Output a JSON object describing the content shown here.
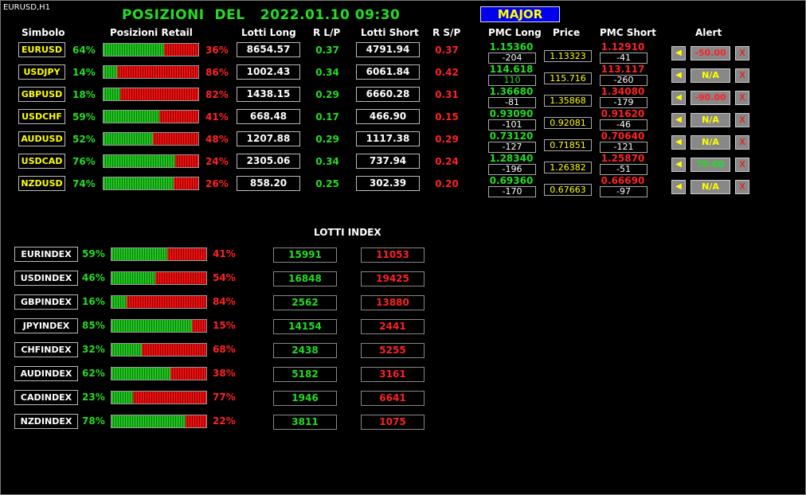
{
  "chart_label": "EURUSD,H1",
  "title": "POSIZIONI  DEL   2022.01.10 09:30",
  "major_button": "MAJOR",
  "headers": {
    "simbolo": "Simbolo",
    "posizioni_retail": "Posizioni Retail",
    "lotti_long": "Lotti Long",
    "r_lp": "R L/P",
    "lotti_short": "Lotti Short",
    "r_sp": "R S/P",
    "pmc_long": "PMC Long",
    "price": "Price",
    "pmc_short": "PMC Short",
    "alert": "Alert"
  },
  "pairs": [
    {
      "symbol": "EURUSD",
      "long_pct": "64%",
      "short_pct": "36%",
      "long_frac": 0.64,
      "lotti_long": "8654.57",
      "r_lp": "0.37",
      "lotti_short": "4791.94",
      "r_sp": "0.37",
      "pmc_long": "1.15360",
      "pmc_long_diff": "-204",
      "pmc_long_diff_color": "#ffffff",
      "price": "1.13323",
      "pmc_short": "1.12910",
      "pmc_short_diff": "-41",
      "alert_value": "-50.00",
      "alert_color": "#ff2222"
    },
    {
      "symbol": "USDJPY",
      "long_pct": "14%",
      "short_pct": "86%",
      "long_frac": 0.14,
      "lotti_long": "1002.43",
      "r_lp": "0.34",
      "lotti_short": "6061.84",
      "r_sp": "0.42",
      "pmc_long": "114.618",
      "pmc_long_diff": "110",
      "pmc_long_diff_color": "#22dd22",
      "price": "115.716",
      "pmc_short": "113.117",
      "pmc_short_diff": "-260",
      "alert_value": "N/A",
      "alert_color": "#ffff00"
    },
    {
      "symbol": "GBPUSD",
      "long_pct": "18%",
      "short_pct": "82%",
      "long_frac": 0.18,
      "lotti_long": "1438.15",
      "r_lp": "0.29",
      "lotti_short": "6660.28",
      "r_sp": "0.31",
      "pmc_long": "1.36680",
      "pmc_long_diff": "-81",
      "pmc_long_diff_color": "#ffffff",
      "price": "1.35868",
      "pmc_short": "1.34080",
      "pmc_short_diff": "-179",
      "alert_value": "-90.00",
      "alert_color": "#ff2222"
    },
    {
      "symbol": "USDCHF",
      "long_pct": "59%",
      "short_pct": "41%",
      "long_frac": 0.59,
      "lotti_long": "668.48",
      "r_lp": "0.17",
      "lotti_short": "466.90",
      "r_sp": "0.15",
      "pmc_long": "0.93090",
      "pmc_long_diff": "-101",
      "pmc_long_diff_color": "#ffffff",
      "price": "0.92081",
      "pmc_short": "0.91620",
      "pmc_short_diff": "-46",
      "alert_value": "N/A",
      "alert_color": "#ffff00"
    },
    {
      "symbol": "AUDUSD",
      "long_pct": "52%",
      "short_pct": "48%",
      "long_frac": 0.52,
      "lotti_long": "1207.88",
      "r_lp": "0.29",
      "lotti_short": "1117.38",
      "r_sp": "0.29",
      "pmc_long": "0.73120",
      "pmc_long_diff": "-127",
      "pmc_long_diff_color": "#ffffff",
      "price": "0.71851",
      "pmc_short": "0.70640",
      "pmc_short_diff": "-121",
      "alert_value": "N/A",
      "alert_color": "#ffff00"
    },
    {
      "symbol": "USDCAD",
      "long_pct": "76%",
      "short_pct": "24%",
      "long_frac": 0.76,
      "lotti_long": "2305.06",
      "r_lp": "0.34",
      "lotti_short": "737.94",
      "r_sp": "0.24",
      "pmc_long": "1.28340",
      "pmc_long_diff": "-196",
      "pmc_long_diff_color": "#ffffff",
      "price": "1.26382",
      "pmc_short": "1.25870",
      "pmc_short_diff": "-51",
      "alert_value": "70.00",
      "alert_color": "#22dd22"
    },
    {
      "symbol": "NZDUSD",
      "long_pct": "74%",
      "short_pct": "26%",
      "long_frac": 0.74,
      "lotti_long": "858.20",
      "r_lp": "0.25",
      "lotti_short": "302.39",
      "r_sp": "0.20",
      "pmc_long": "0.69360",
      "pmc_long_diff": "-170",
      "pmc_long_diff_color": "#ffffff",
      "price": "0.67663",
      "pmc_short": "0.66690",
      "pmc_short_diff": "-97",
      "alert_value": "N/A",
      "alert_color": "#ffff00"
    }
  ],
  "alert_bell_icon": "bell-icon",
  "alert_close_label": "X",
  "lotti_index_title": "LOTTI INDEX",
  "indices": [
    {
      "name": "EURINDEX",
      "long_pct": "59%",
      "short_pct": "41%",
      "long_frac": 0.59,
      "long_lots": "15991",
      "short_lots": "11053"
    },
    {
      "name": "USDINDEX",
      "long_pct": "46%",
      "short_pct": "54%",
      "long_frac": 0.46,
      "long_lots": "16848",
      "short_lots": "19425"
    },
    {
      "name": "GBPINDEX",
      "long_pct": "16%",
      "short_pct": "84%",
      "long_frac": 0.16,
      "long_lots": "2562",
      "short_lots": "13880"
    },
    {
      "name": "JPYINDEX",
      "long_pct": "85%",
      "short_pct": "15%",
      "long_frac": 0.85,
      "long_lots": "14154",
      "short_lots": "2441"
    },
    {
      "name": "CHFINDEX",
      "long_pct": "32%",
      "short_pct": "68%",
      "long_frac": 0.32,
      "long_lots": "2438",
      "short_lots": "5255"
    },
    {
      "name": "AUDINDEX",
      "long_pct": "62%",
      "short_pct": "38%",
      "long_frac": 0.62,
      "long_lots": "5182",
      "short_lots": "3161"
    },
    {
      "name": "CADINDEX",
      "long_pct": "23%",
      "short_pct": "77%",
      "long_frac": 0.23,
      "long_lots": "1946",
      "short_lots": "6641"
    },
    {
      "name": "NZDINDEX",
      "long_pct": "78%",
      "short_pct": "22%",
      "long_frac": 0.78,
      "long_lots": "3811",
      "short_lots": "1075"
    }
  ]
}
